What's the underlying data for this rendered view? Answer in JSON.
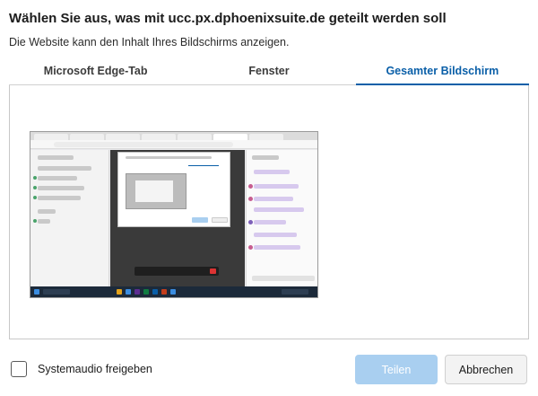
{
  "dialog": {
    "title": "Wählen Sie aus, was mit ucc.px.dphoenixsuite.de geteilt werden soll",
    "subtitle": "Die Website kann den Inhalt Ihres Bildschirms anzeigen."
  },
  "tabs": [
    {
      "label": "Microsoft Edge-Tab",
      "active": false
    },
    {
      "label": "Fenster",
      "active": false
    },
    {
      "label": "Gesamter Bildschirm",
      "active": true
    }
  ],
  "footer": {
    "audio_label": "Systemaudio freigeben",
    "audio_checked": false,
    "share_label": "Teilen",
    "cancel_label": "Abbrechen"
  },
  "colors": {
    "accent": "#0a5fa8",
    "share_disabled": "#a9cff0"
  }
}
